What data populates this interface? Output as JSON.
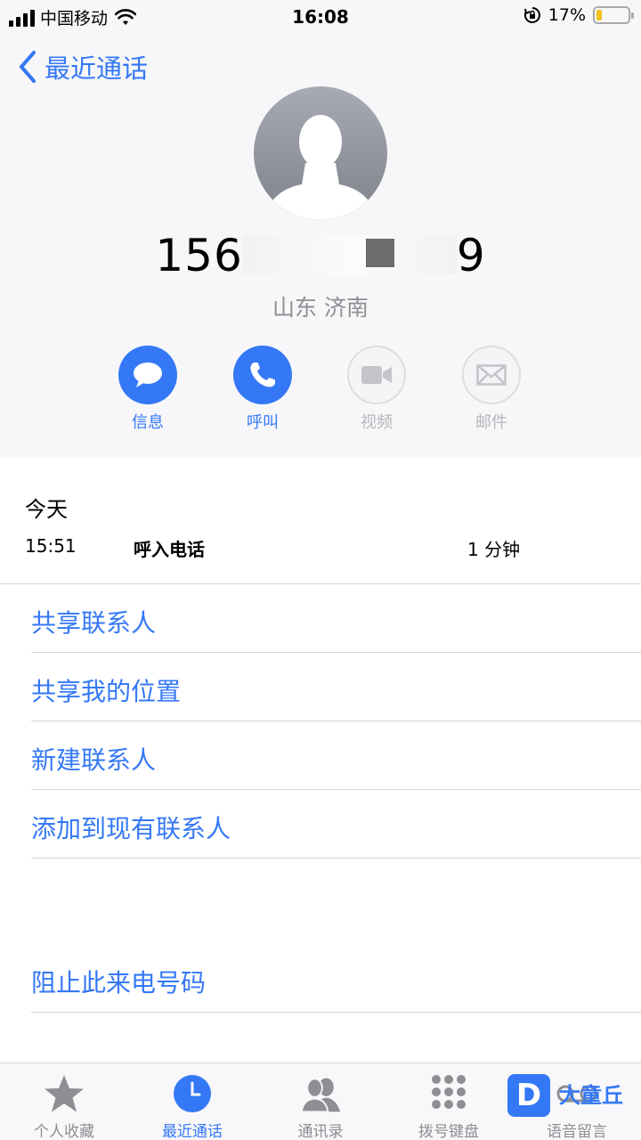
{
  "status_bar": {
    "carrier": "中国移动",
    "time": "16:08",
    "battery_percent": "17%",
    "battery_level": 0.17,
    "icons": [
      "signal-bars-icon",
      "wifi-icon",
      "rotation-lock-icon",
      "battery-icon"
    ]
  },
  "nav": {
    "back_label": "最近通话",
    "back_icon": "chevron-left-icon"
  },
  "contact": {
    "avatar_icon": "person-silhouette-icon",
    "phone_prefix": "156",
    "phone_suffix": "9",
    "location": "山东 济南"
  },
  "actions": [
    {
      "label": "信息",
      "icon": "message-bubble-icon",
      "enabled": true
    },
    {
      "label": "呼叫",
      "icon": "phone-icon",
      "enabled": true
    },
    {
      "label": "视频",
      "icon": "video-camera-icon",
      "enabled": false
    },
    {
      "label": "邮件",
      "icon": "mail-envelope-icon",
      "enabled": false
    }
  ],
  "call_log": {
    "day": "今天",
    "entries": [
      {
        "time": "15:51",
        "type": "呼入电话",
        "duration": "1 分钟"
      }
    ]
  },
  "options": [
    {
      "label": "共享联系人"
    },
    {
      "label": "共享我的位置"
    },
    {
      "label": "新建联系人"
    },
    {
      "label": "添加到现有联系人"
    }
  ],
  "block_option": {
    "label": "阻止此来电号码"
  },
  "tab_bar": {
    "tabs": [
      {
        "label": "个人收藏",
        "icon": "star-icon",
        "active": false
      },
      {
        "label": "最近通话",
        "icon": "clock-icon",
        "active": true
      },
      {
        "label": "通讯录",
        "icon": "contacts-icon",
        "active": false
      },
      {
        "label": "拨号键盘",
        "icon": "keypad-icon",
        "active": false
      },
      {
        "label": "语音留言",
        "icon": "voicemail-icon",
        "active": false
      }
    ]
  },
  "watermark": {
    "badge": "D",
    "text": "大童丘"
  },
  "colors": {
    "accent": "#3478f6",
    "disabled": "#b6b6bb",
    "secondary_text": "#8e8e93",
    "header_bg": "#f7f7f9",
    "battery_low": "#f1c21b"
  }
}
